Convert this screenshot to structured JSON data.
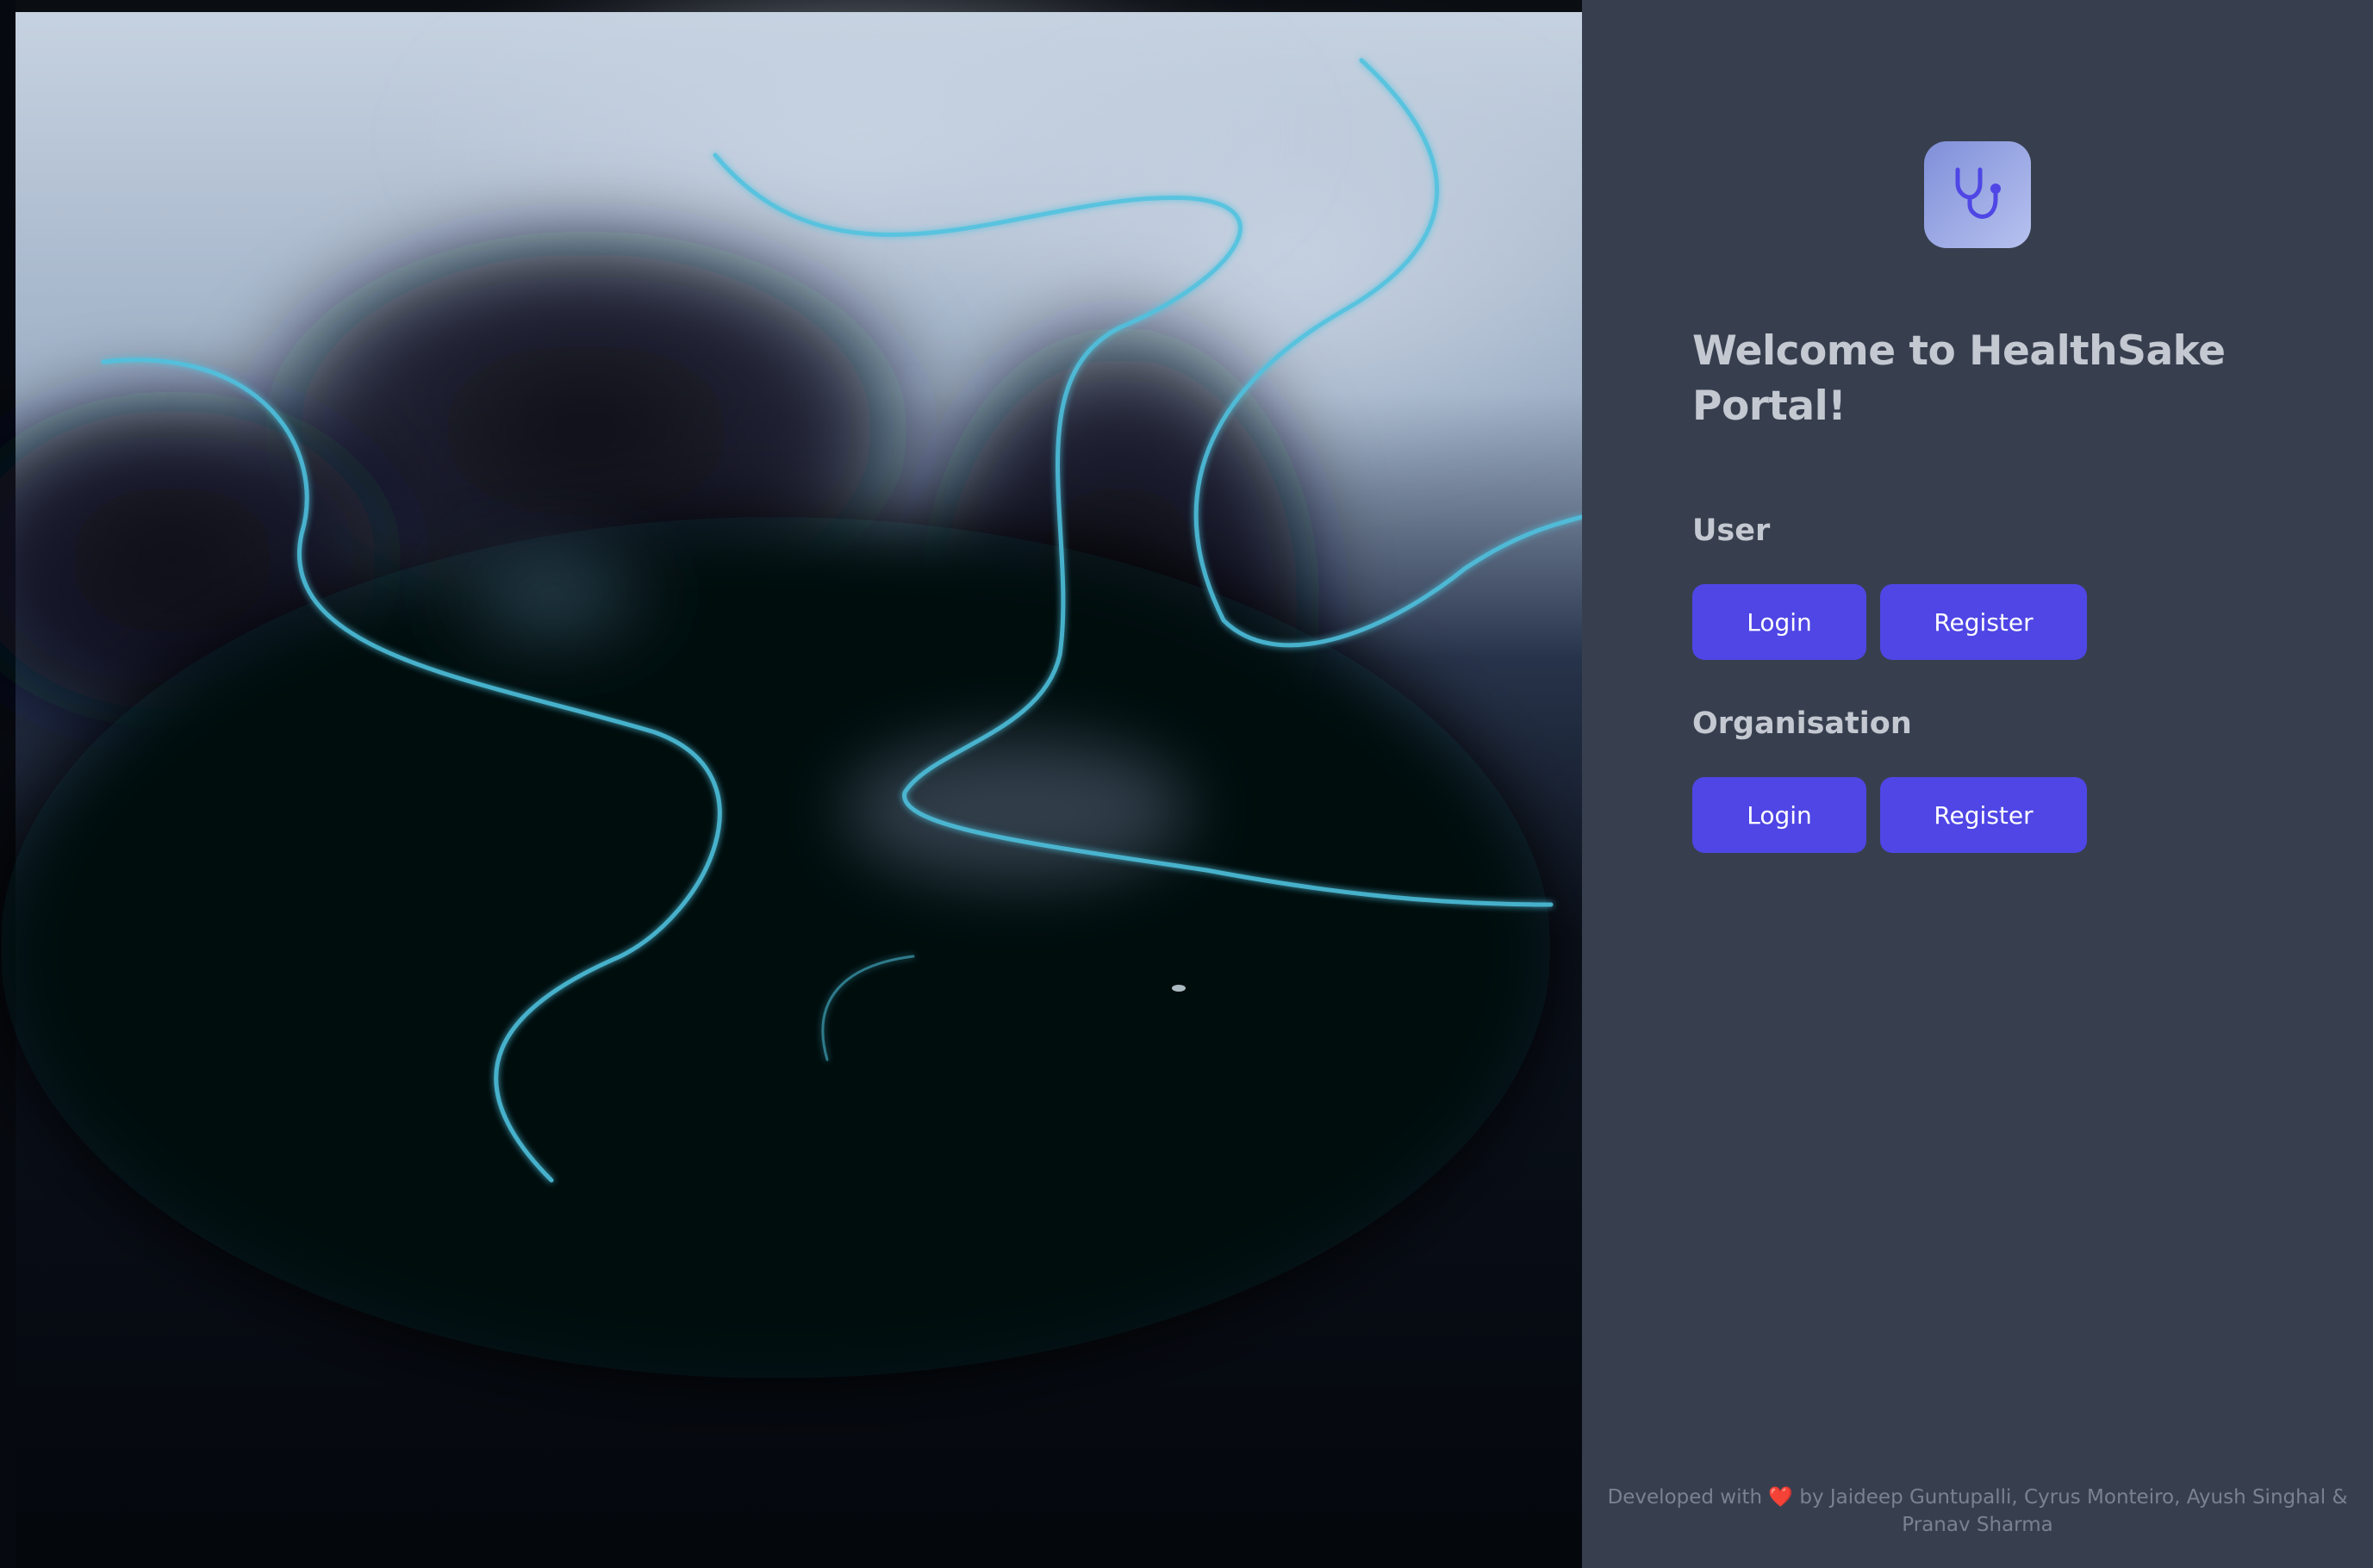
{
  "hero": {
    "image": "abstract-smoke-wave-artwork"
  },
  "logo": {
    "icon": "stethoscope-icon",
    "tile_color": "#9aa7e6",
    "icon_color": "#4f46e5"
  },
  "welcome": {
    "title": "Welcome to HealthSake Portal!"
  },
  "user_section": {
    "heading": "User",
    "login_label": "Login",
    "register_label": "Register"
  },
  "org_section": {
    "heading": "Organisation",
    "login_label": "Login",
    "register_label": "Register"
  },
  "footer": {
    "prefix": "Developed with",
    "heart": "❤️",
    "credits": "by Jaideep Guntupalli, Cyrus Monteiro, Ayush Singhal & Pranav Sharma"
  },
  "colors": {
    "panel_bg": "#373f4f",
    "button_bg": "#4f46e5",
    "text": "#c4c8d1",
    "footer_text": "#7a8191"
  }
}
